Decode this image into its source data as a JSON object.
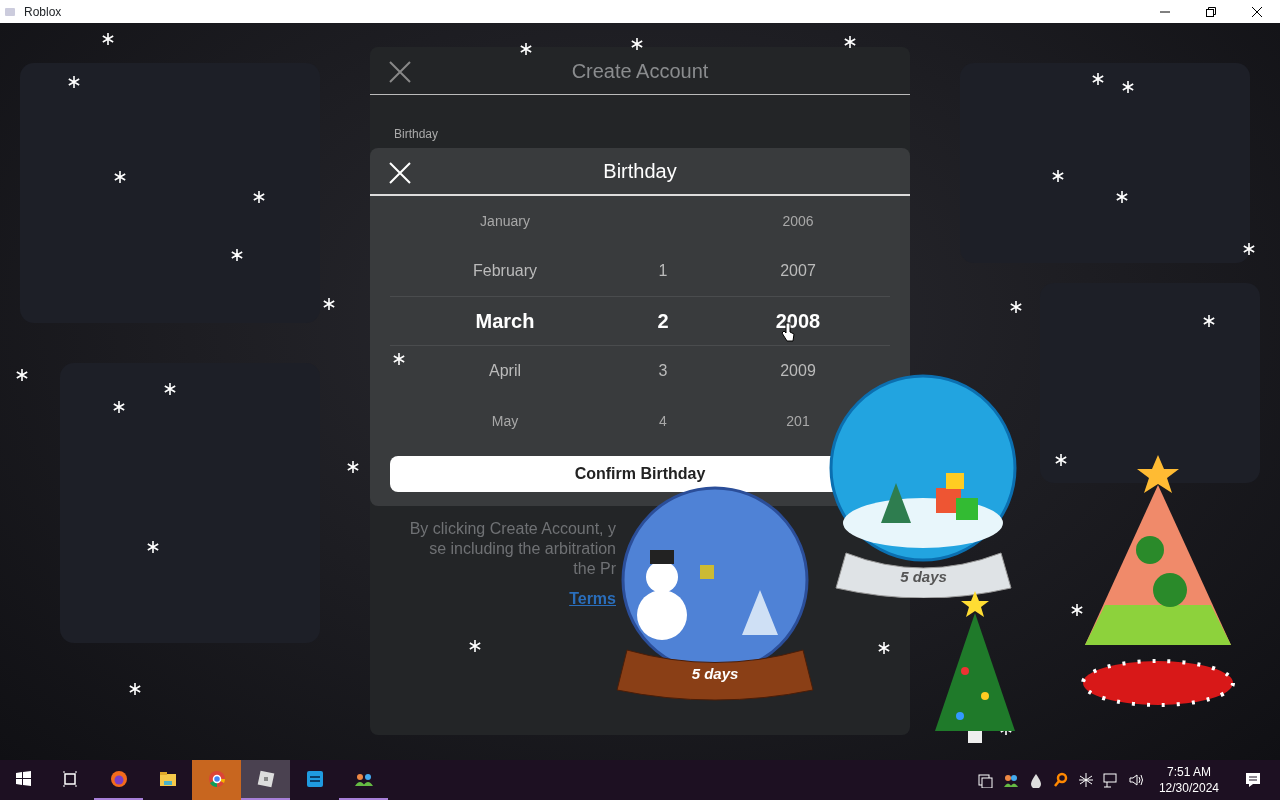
{
  "window": {
    "title": "Roblox"
  },
  "dialog": {
    "title": "Create Account",
    "field_label": "Birthday",
    "terms_lines": [
      "By clicking Create Account, y",
      "se including the arbitration",
      "the Pr"
    ],
    "terms_link": "Terms"
  },
  "picker": {
    "title": "Birthday",
    "confirm_button": "Confirm Birthday",
    "rows": [
      {
        "month": "January",
        "year": "2006",
        "selected": false
      },
      {
        "month": "February",
        "day": "1",
        "year": "2007",
        "selected": false
      },
      {
        "month": "March",
        "day": "2",
        "year": "2008",
        "selected": true
      },
      {
        "month": "April",
        "day": "3",
        "year": "2009",
        "selected": false
      },
      {
        "month": "May",
        "day": "4",
        "year": "201",
        "selected": false
      }
    ]
  },
  "snow_globes": [
    {
      "kind": "presents",
      "label": "5 days"
    },
    {
      "kind": "snowman",
      "label": "5 days"
    }
  ],
  "taskbar": {
    "apps": [
      {
        "kind": "start",
        "running": false,
        "flashing": false,
        "selected": false
      },
      {
        "kind": "taskview",
        "running": false,
        "flashing": false,
        "selected": false
      },
      {
        "kind": "firefox",
        "running": true,
        "flashing": false,
        "selected": false
      },
      {
        "kind": "files",
        "running": false,
        "flashing": false,
        "selected": false
      },
      {
        "kind": "chrome",
        "running": true,
        "flashing": true,
        "selected": false
      },
      {
        "kind": "roblox",
        "running": true,
        "flashing": false,
        "selected": true
      },
      {
        "kind": "studio",
        "running": false,
        "flashing": false,
        "selected": false
      },
      {
        "kind": "people",
        "running": true,
        "flashing": false,
        "selected": false
      }
    ],
    "time": "7:51 AM",
    "date": "12/30/2024"
  }
}
